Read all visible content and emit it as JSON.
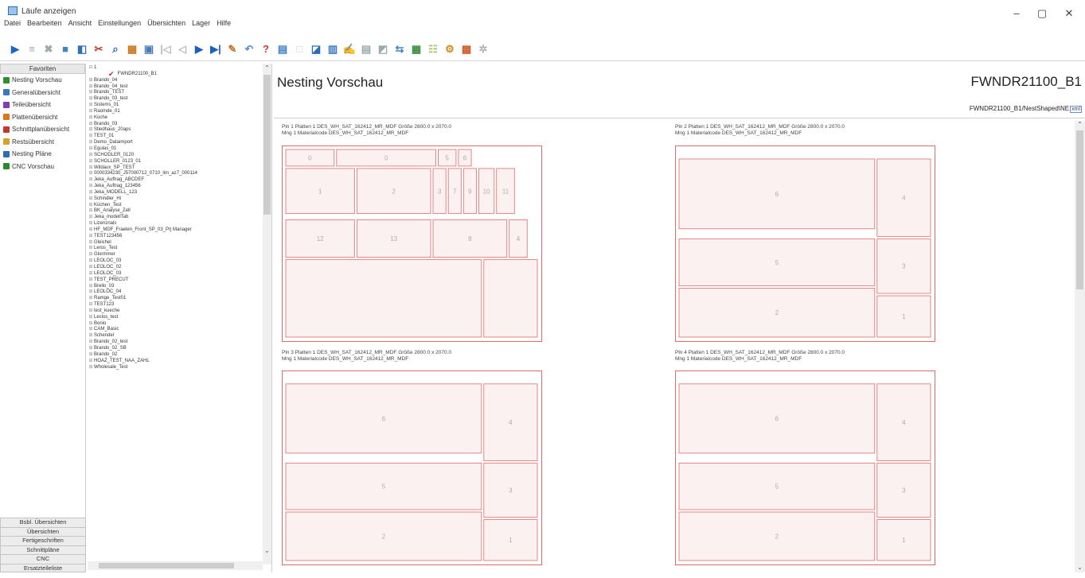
{
  "window": {
    "title": "Läufe anzeigen",
    "minimize": "–",
    "maximize": "▢",
    "close": "✕"
  },
  "menu": [
    "Datei",
    "Bearbeiten",
    "Ansicht",
    "Einstellungen",
    "Übersichten",
    "Lager",
    "Hilfe"
  ],
  "toolbar_icons": [
    "exit-icon",
    "list-icon",
    "delete-icon",
    "copy-icon",
    "import-icon",
    "cut-icon",
    "search-icon",
    "filter-icon",
    "print-icon",
    "first-icon",
    "prev-icon",
    "next-icon",
    "last-icon",
    "edit-icon",
    "undo-icon",
    "help-icon",
    "monitor-icon",
    "window-icon",
    "nesting-icon",
    "report-icon",
    "write-icon",
    "save-icon",
    "export-icon",
    "link-icon",
    "plan-icon",
    "optimize-icon",
    "cnc-icon",
    "stack-icon",
    "settings-icon"
  ],
  "favorites": {
    "header": "Favoriten",
    "items": [
      {
        "label": "Nesting Vorschau",
        "color": "#2f8f2f"
      },
      {
        "label": "Generalübersicht",
        "color": "#3a78c2"
      },
      {
        "label": "Teileübersicht",
        "color": "#7d3fb5"
      },
      {
        "label": "Plattenübersicht",
        "color": "#d4791c"
      },
      {
        "label": "Schnittplanübersicht",
        "color": "#c23a2b"
      },
      {
        "label": "Restsübersicht",
        "color": "#d8a22a"
      },
      {
        "label": "Nesting Pläne",
        "color": "#2a6fb0"
      },
      {
        "label": "CNC Vorschau",
        "color": "#2c8a2c"
      }
    ]
  },
  "sections": [
    "Bsbl. Übersichten",
    "Übersichten",
    "Fertigeschriften",
    "Schnittpläne",
    "CNC",
    "Ersatzteileliste"
  ],
  "tree": {
    "root": "1",
    "selected": "FWNDR21100_B1",
    "items": [
      "Brando_04",
      "Brando_04_test",
      "Brando_TEST",
      "Brando_03_test",
      "Sistems_01",
      "Raomde_01",
      "Küche",
      "Brando_03",
      "Stiedhaus_20aps",
      "TEST_01",
      "Demo_Dataimport",
      "Egulas_01",
      "SCHODLER_0120",
      "SCHOLLER_0123_01",
      "Wildaux_SP_TEST",
      "0000334230_J57000712_0710_lim_az7_000114",
      "Jeka_Auftrag_ABCDEF",
      "Jeka_Auftrag_123456",
      "Jeka_MODELL_123",
      "Schindler_Hi",
      "Küchen_Test",
      "BK_Analyse_Zell",
      "Jeka_modellTab",
      "Lizenznals",
      "HF_MDF_Fraelen_Front_SP_03_Prj Manager",
      "TEST123456",
      "Gleichel",
      "Leros_Test",
      "Glormmer",
      "LEOLOC_03",
      "LEOLOC_02",
      "LEOLOC_03",
      "TEST_PRECUT",
      "Brello_03",
      "LEOLOC_04",
      "Ramge_Test01",
      "TEST123",
      "test_kueche",
      "Leclos_test",
      "Bonio",
      "CAM_Basic",
      "Schendel",
      "Brando_02_test",
      "Brando_02_SB",
      "Brando_02",
      "HOAZ_TEST_NAA_ZAHL",
      "Wholesale_Test"
    ]
  },
  "main": {
    "title": "Nesting Vorschau",
    "id": "FWNDR21100_B1",
    "path": "FWNDR21100_B1/NestShaped\\NE",
    "path_badge": "xml"
  },
  "plates": [
    {
      "line1": "Pln 1  Platten 1 DES_WH_SAT_162412_MR_MDF  Größe 2800.0 x 2070.0",
      "line2": "Mng 1  Materialcode DES_WH_SAT_162412_MR_MDF",
      "labels": [
        "0",
        "0",
        "5",
        "6",
        "1",
        "2",
        "3",
        "7",
        "9",
        "10",
        "11",
        "12",
        "13",
        "8",
        "4"
      ]
    },
    {
      "line1": "Pln 2  Platten 1 DES_WH_SAT_162412_MR_MDF  Größe 2800.0 x 2070.0",
      "line2": "Mng 1  Materialcode DES_WH_SAT_162412_MR_MDF",
      "labels": [
        "6",
        "4",
        "5",
        "3",
        "2",
        "1"
      ]
    },
    {
      "line1": "Pln 3  Platten 1 DES_WH_SAT_162412_MR_MDF  Größe 2800.0 x 2070.0",
      "line2": "Mng 1  Materialcode DES_WH_SAT_162412_MR_MDF",
      "labels": [
        "6",
        "4",
        "5",
        "3",
        "2",
        "1"
      ]
    },
    {
      "line1": "Pln 4  Platten 1 DES_WH_SAT_162412_MR_MDF  Größe 2800.0 x 2070.0",
      "line2": "Mng 1  Materialcode DES_WH_SAT_162412_MR_MDF",
      "labels": [
        "6",
        "4",
        "5",
        "3",
        "2",
        "1"
      ]
    }
  ],
  "colors": {
    "cut_line": "#e06a6a",
    "panel_fill": "#fbf1f1",
    "accent": "#c1272d"
  }
}
